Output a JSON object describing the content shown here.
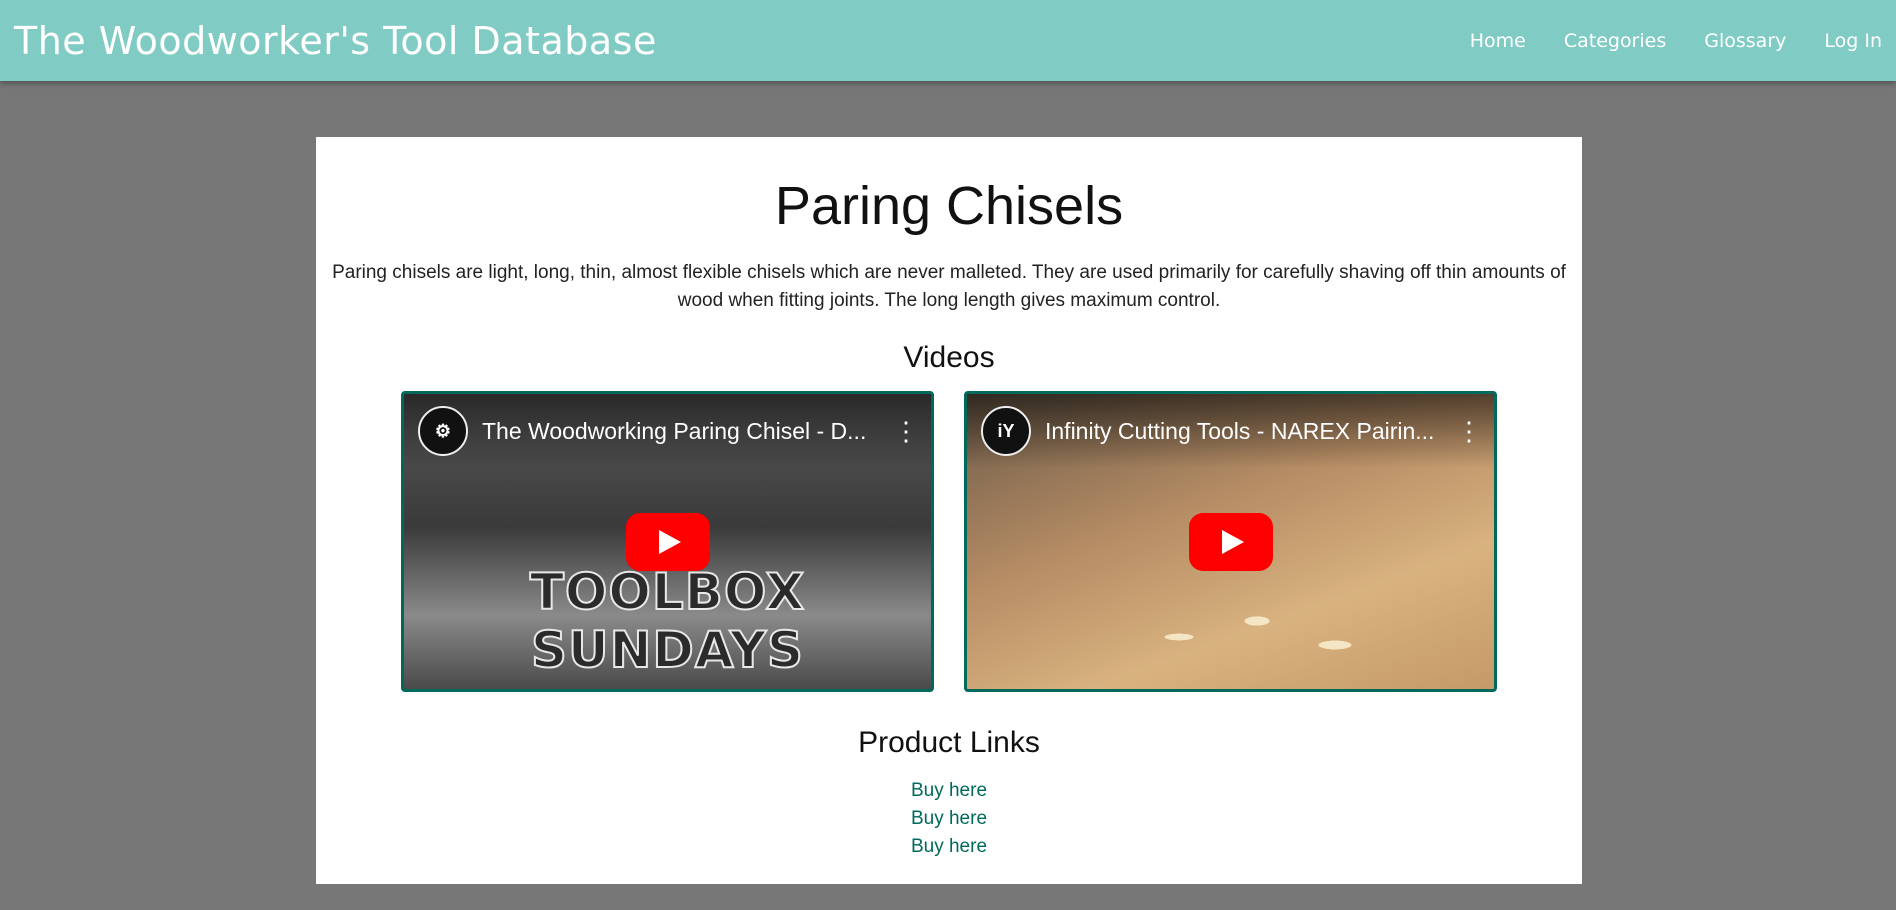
{
  "header": {
    "brand": "The Woodworker's Tool Database",
    "nav": [
      "Home",
      "Categories",
      "Glossary",
      "Log In"
    ]
  },
  "page": {
    "title": "Paring Chisels",
    "description": "Paring chisels are light, long, thin, almost flexible chisels which are never malleted. They are used primarily for carefully shaving off thin amounts of wood when fitting joints. The long length gives maximum control.",
    "videos_heading": "Videos",
    "videos": [
      {
        "title": "The Woodworking Paring Chisel - D...",
        "overlay_text": "TOOLBOX SUNDAYS",
        "channel_icon": "sawblade-logo-icon"
      },
      {
        "title": "Infinity Cutting Tools - NAREX Pairin...",
        "overlay_text": "",
        "channel_icon": "iy-logo-icon"
      }
    ],
    "products_heading": "Product Links",
    "product_links": [
      "Buy here",
      "Buy here",
      "Buy here"
    ]
  },
  "colors": {
    "header_bg": "#80cbc4",
    "page_bg": "#777777",
    "accent": "#00695c",
    "play_button": "#ff0000"
  }
}
